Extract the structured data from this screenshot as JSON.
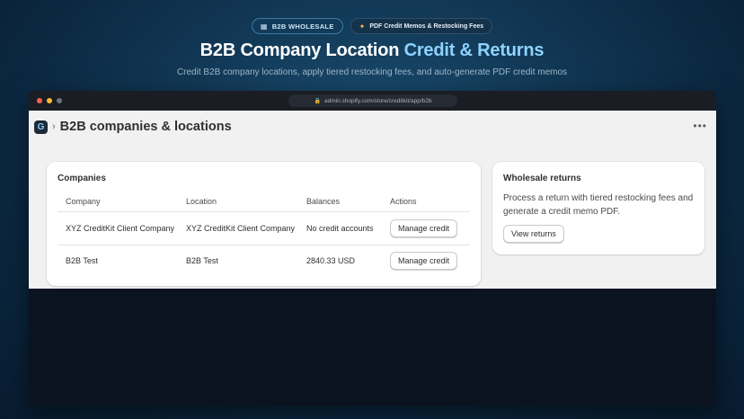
{
  "badges": {
    "primary": {
      "icon": "building-icon",
      "label": "B2B WHOLESALE"
    },
    "secondary": {
      "icon": "sparkle-icon",
      "label": "PDF Credit Memos & Restocking Fees"
    }
  },
  "hero": {
    "title_main": "B2B Company Location ",
    "title_accent": "Credit & Returns",
    "subtitle": "Credit B2B company locations, apply tiered restocking fees, and auto-generate PDF credit memos"
  },
  "browser": {
    "url": "admin.shopify.com/store/creditkit/app/b2b",
    "traffic_lights": [
      "#ff5f57",
      "#febc2e",
      "#6b7280"
    ]
  },
  "app": {
    "logo_letter": "G",
    "breadcrumb_separator": "›",
    "page_title": "B2B companies & locations",
    "more_label": "•••"
  },
  "companies_card": {
    "title": "Companies",
    "columns": [
      "Company",
      "Location",
      "Balances",
      "Actions"
    ],
    "rows": [
      {
        "company": "XYZ CreditKit Client Company",
        "location": "XYZ CreditKit Client Company",
        "balance": "No credit accounts",
        "action": "Manage credit"
      },
      {
        "company": "B2B Test",
        "location": "B2B Test",
        "balance": "2840.33 USD",
        "action": "Manage credit"
      }
    ]
  },
  "returns_card": {
    "title": "Wholesale returns",
    "description": "Process a return with tiered restocking fees and generate a credit memo PDF.",
    "button": "View returns"
  },
  "colors": {
    "accent": "#8fd3ff",
    "background": "#0b2740",
    "app_bg": "#f1f1f1"
  }
}
